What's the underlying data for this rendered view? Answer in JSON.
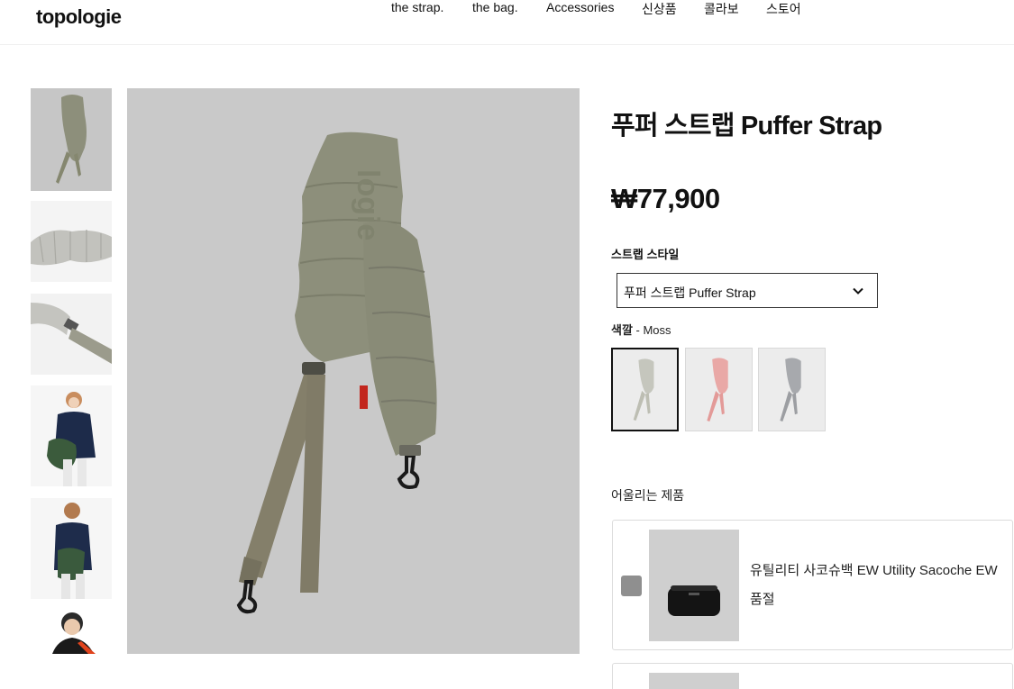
{
  "brand": {
    "logo_text": "topologie"
  },
  "nav": {
    "items": [
      {
        "label": "the strap."
      },
      {
        "label": "the bag."
      },
      {
        "label": "Accessories"
      },
      {
        "label": "신상품"
      },
      {
        "label": "콜라보"
      },
      {
        "label": "스토어"
      }
    ]
  },
  "gallery": {
    "thumbnails": [
      {
        "icon": "strap-moss-thumbnail"
      },
      {
        "icon": "puffer-closeup-thumbnail"
      },
      {
        "icon": "buckle-detail-thumbnail"
      },
      {
        "icon": "model-wearing-thumbnail"
      },
      {
        "icon": "model-back-thumbnail"
      },
      {
        "icon": "model-portrait-thumbnail"
      }
    ],
    "main_image": "puffer-strap-moss-image"
  },
  "product": {
    "title": "푸퍼 스트랩 Puffer Strap",
    "price": "₩77,900",
    "style_label": "스트랩 스타일",
    "style_selected": "푸퍼 스트랩 Puffer Strap",
    "color_label": "색깔",
    "color_value": " - Moss",
    "swatches": [
      {
        "name": "Moss",
        "color": "#9a9c8e",
        "selected": true
      },
      {
        "name": "Pink",
        "color": "#e9a8a6",
        "selected": false
      },
      {
        "name": "Grey",
        "color": "#a7a9ad",
        "selected": false
      }
    ]
  },
  "related": {
    "label": "어울리는 제품",
    "items": [
      {
        "name": "유틸리티 사코슈백 EW Utility Sacoche EW",
        "status": "품절"
      }
    ]
  },
  "colors": {
    "strap_moss": "#8d8f7b",
    "image_bg": "#c9c9c9",
    "text": "#111111"
  }
}
